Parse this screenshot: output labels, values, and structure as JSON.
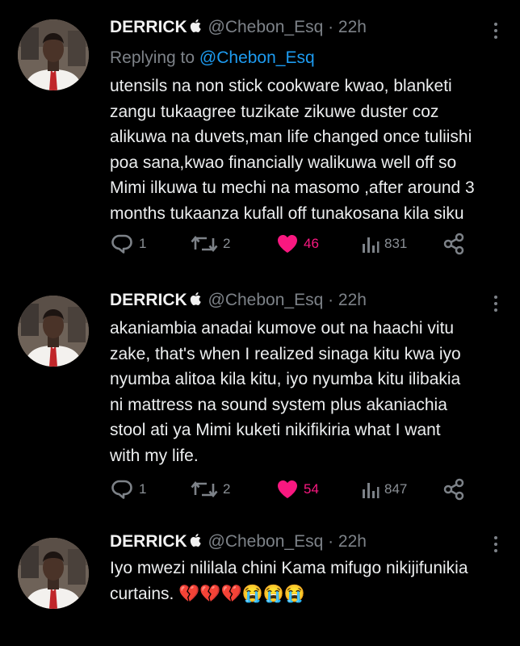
{
  "tweets": [
    {
      "name": "DERRICK",
      "handle": "@Chebon_Esq",
      "time": "· 22h",
      "replying_to_prefix": "Replying to ",
      "replying_to_handle": "@Chebon_Esq",
      "text": "utensils na non stick cookware kwao, blanketi\nzangu tukaagree tuzikate zikuwe duster coz\nalikuwa na duvets,man life changed once tuliishi\npoa sana,kwao financially walikuwa well off so\nMimi ilkuwa tu mechi na masomo ,after around 3\nmonths tukaanza kufall off tunakosana kila siku",
      "replies": "1",
      "retweets": "2",
      "likes": "46",
      "views": "831"
    },
    {
      "name": "DERRICK",
      "handle": "@Chebon_Esq",
      "time": "· 22h",
      "text": "akaniambia anadai kumove out na haachi vitu\nzake, that's when I realized sinaga kitu kwa iyo\nnyumba alitoa kila kitu, iyo nyumba kitu ilibakia\nni mattress na sound system plus akaniachia\nstool ati ya Mimi kuketi nikifikiria what I want\nwith my life.",
      "replies": "1",
      "retweets": "2",
      "likes": "54",
      "views": "847"
    },
    {
      "name": "DERRICK",
      "handle": "@Chebon_Esq",
      "time": "· 22h",
      "text": "Iyo mwezi nililala chini Kama mifugo nikijifunikia\ncurtains. 💔💔💔😭😭😭"
    }
  ],
  "colors": {
    "background": "#000000",
    "text": "#e7e9ea",
    "muted": "#7d8288",
    "link": "#1d9bf0",
    "like": "#f91880"
  },
  "icons": [
    "apple-logo-icon",
    "more-options-icon",
    "reply-icon",
    "retweet-icon",
    "heart-icon",
    "views-icon",
    "share-icon"
  ]
}
